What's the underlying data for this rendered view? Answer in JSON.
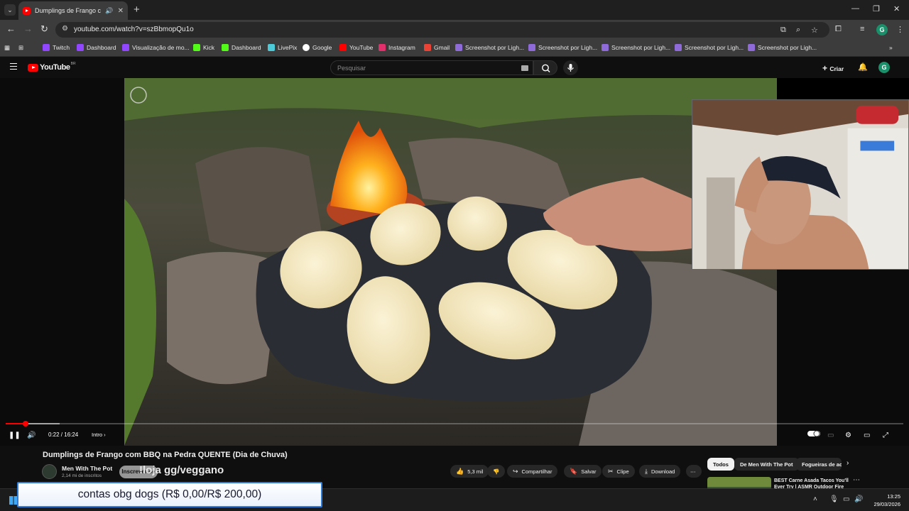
{
  "browser": {
    "tab": {
      "title": "Dumplings de Frango com",
      "close": "✕"
    },
    "new_tab": "+",
    "url": "youtube.com/watch?v=szBbmopQu1o",
    "bookmarks": [
      {
        "label": "Twitch",
        "color": "#9146ff"
      },
      {
        "label": "Dashboard",
        "color": "#9146ff"
      },
      {
        "label": "Visualização de mo...",
        "color": "#9146ff"
      },
      {
        "label": "Kick",
        "color": "#53fc18"
      },
      {
        "label": "Dashboard",
        "color": "#53fc18"
      },
      {
        "label": "LivePix",
        "color": "#4ec9d8"
      },
      {
        "label": "Google",
        "color": "#ffffff"
      },
      {
        "label": "YouTube",
        "color": "#ff0000"
      },
      {
        "label": "Instagram",
        "color": "#e1306c"
      },
      {
        "label": "Gmail",
        "color": "#ea4335"
      },
      {
        "label": "Screenshot por Ligh...",
        "color": "#8e6bd8"
      },
      {
        "label": "Screenshot por Ligh...",
        "color": "#8e6bd8"
      },
      {
        "label": "Screenshot por Ligh...",
        "color": "#8e6bd8"
      },
      {
        "label": "Screenshot por Ligh...",
        "color": "#8e6bd8"
      },
      {
        "label": "Screenshot por Ligh...",
        "color": "#8e6bd8"
      }
    ],
    "profile_initial": "G"
  },
  "youtube": {
    "logo_text": "YouTube",
    "logo_region": "BR",
    "search_placeholder": "Pesquisar",
    "create_label": "Criar",
    "avatar_initial": "G"
  },
  "player": {
    "time": "0:22 / 16:24",
    "chapter": "Intro",
    "progress_fraction": 0.022,
    "buffered_fraction": 0.06
  },
  "video": {
    "title": "Dumplings de Frango com BBQ na Pedra QUENTE (Dia de Chuva)",
    "channel": "Men With The Pot",
    "subscribers": "2,14 mi de inscritos",
    "subscribe_label": "Inscrever-se",
    "overlay_text": "!loja gg/veggano",
    "actions": {
      "likes": "5,3 mil",
      "share": "Compartilhar",
      "save": "Salvar",
      "clip": "Clipe",
      "download": "Download",
      "more": "⋯"
    }
  },
  "recommendations": {
    "chips": [
      "Todos",
      "De Men With The Pot",
      "Fogueiras de ac"
    ],
    "first_title": "BEST Carne Asada Tacos You'll Ever Try | ASMR Outdoor Fire"
  },
  "overlay": {
    "donation_text": "contas obg dogs (R$ 0,00/R$ 200,00)"
  },
  "taskbar": {
    "time": "13:25",
    "date": "29/03/2026"
  },
  "colors": {
    "accent_red": "#ff0000",
    "donation_border": "#2f7bd8",
    "profile_green": "#1a8f6a"
  }
}
